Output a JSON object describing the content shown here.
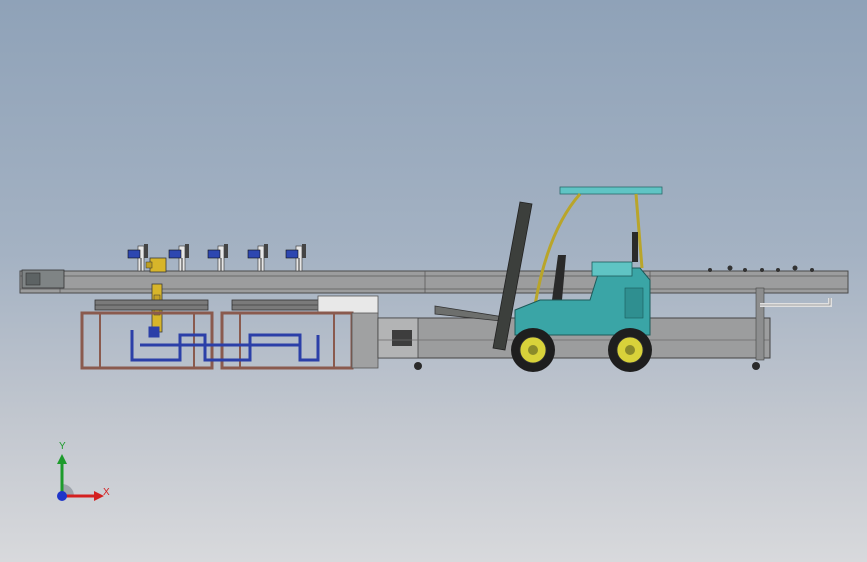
{
  "viewport": {
    "background_top": "#8fa2b8",
    "background_bottom": "#d8d9dc"
  },
  "model": {
    "parts": [
      "conveyor-beam",
      "robot-arm",
      "spray-heads",
      "pallet-cell-frames",
      "blue-piping",
      "forklift",
      "return-conveyor"
    ],
    "colors": {
      "beam": "#9a9a9a",
      "frame": "#8a5a4e",
      "pipe": "#2b3fa8",
      "forklift_body": "#3aa5a6",
      "forklift_roof": "#5fc4c4",
      "forklift_mast": "#3c3f3c",
      "robot": "#d7b52a",
      "wheel_rim": "#d8d23a",
      "wheel_tire": "#1e1e1e"
    }
  },
  "triad": {
    "y_label": "Y",
    "x_label": "X",
    "y_color": "#1d9b2c",
    "x_color": "#d42020",
    "z_color": "#1f35c9"
  }
}
